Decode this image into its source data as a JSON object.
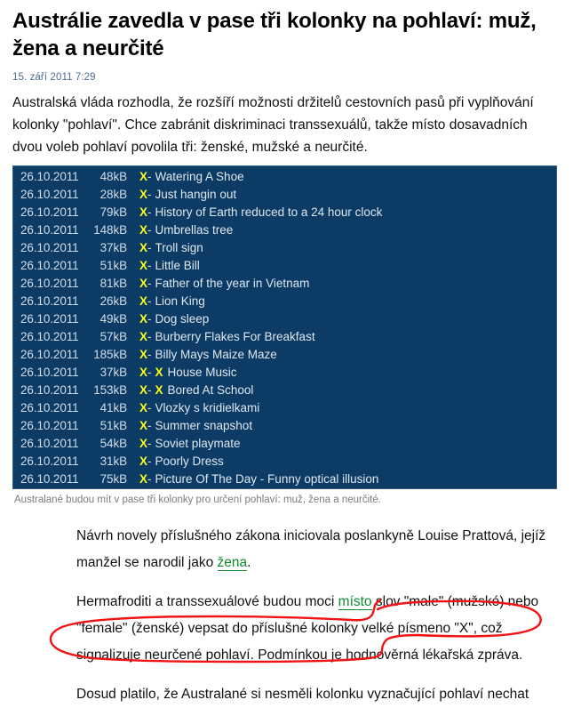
{
  "article": {
    "headline": "Austrálie zavedla v pase tři kolonky na pohlaví: muž, žena a neurčité",
    "dateline": "15. září 2011  7:29",
    "perex": "Australská vláda rozhodla, že rozšíří možnosti držitelů cestovních pasů při vyplňování kolonky \"pohlaví\". Chce zabránit diskriminaci transsexuálů, takže místo dosavadních dvou voleb pohlaví povolila tři: ženské, mužské a neurčité.",
    "image_caption": "Australané budou mít v pase tři kolonky pro určení pohlaví: muž, žena a neurčité."
  },
  "filebox": {
    "marker_glyph": "X",
    "separator": "-",
    "rows": [
      {
        "date": "26.10.2011",
        "size": "48kB",
        "marker": "X",
        "extra_marker": "",
        "title": "Watering A Shoe"
      },
      {
        "date": "26.10.2011",
        "size": "28kB",
        "marker": "X",
        "extra_marker": "",
        "title": "Just hangin out"
      },
      {
        "date": "26.10.2011",
        "size": "79kB",
        "marker": "X",
        "extra_marker": "",
        "title": "History of Earth reduced to a 24 hour clock"
      },
      {
        "date": "26.10.2011",
        "size": "148kB",
        "marker": "X",
        "extra_marker": "",
        "title": "Umbrellas tree"
      },
      {
        "date": "26.10.2011",
        "size": "37kB",
        "marker": "X",
        "extra_marker": "",
        "title": "Troll sign"
      },
      {
        "date": "26.10.2011",
        "size": "51kB",
        "marker": "X",
        "extra_marker": "",
        "title": "Little Bill"
      },
      {
        "date": "26.10.2011",
        "size": "81kB",
        "marker": "X",
        "extra_marker": "",
        "title": "Father of the year in Vietnam"
      },
      {
        "date": "26.10.2011",
        "size": "26kB",
        "marker": "X",
        "extra_marker": "",
        "title": "Lion King"
      },
      {
        "date": "26.10.2011",
        "size": "49kB",
        "marker": "X",
        "extra_marker": "",
        "title": "Dog sleep"
      },
      {
        "date": "26.10.2011",
        "size": "57kB",
        "marker": "X",
        "extra_marker": "",
        "title": "Burberry Flakes For Breakfast"
      },
      {
        "date": "26.10.2011",
        "size": "185kB",
        "marker": "X",
        "extra_marker": "",
        "title": "Billy Mays Maize Maze"
      },
      {
        "date": "26.10.2011",
        "size": "37kB",
        "marker": "X",
        "extra_marker": "X",
        "title": "House Music"
      },
      {
        "date": "26.10.2011",
        "size": "153kB",
        "marker": "X",
        "extra_marker": "X",
        "title": "Bored At School"
      },
      {
        "date": "26.10.2011",
        "size": "41kB",
        "marker": "X",
        "extra_marker": "",
        "title": "Vlozky s kridielkami"
      },
      {
        "date": "26.10.2011",
        "size": "51kB",
        "marker": "X",
        "extra_marker": "",
        "title": "Summer snapshot"
      },
      {
        "date": "26.10.2011",
        "size": "54kB",
        "marker": "X",
        "extra_marker": "",
        "title": "Soviet playmate"
      },
      {
        "date": "26.10.2011",
        "size": "31kB",
        "marker": "X",
        "extra_marker": "",
        "title": "Poorly Dress"
      },
      {
        "date": "26.10.2011",
        "size": "75kB",
        "marker": "X",
        "extra_marker": "",
        "title": "Picture Of The Day - Funny optical illusion"
      }
    ]
  },
  "body": {
    "para1_before_link": "Návrh novely příslušného zákona iniciovala poslankyně Louise Prattová, jejíž manžel se narodil jako ",
    "para1_link": "žena",
    "para1_after_link": ".",
    "para2_before_link": "Hermafroditi a transsexuálové budou moci ",
    "para2_link": "místo",
    "para2_after_link": " slov \"male\" (mužské) nebo \"female\" (ženské) vepsat do příslušné kolonky velké písmeno \"X\", což signalizuje neurčené pohlaví. Podmínkou je hodnověrná lékařská zpráva.",
    "para3": "Dosud platilo, že Australané si nesměli kolonku vyznačující pohlaví nechat"
  },
  "annotation": {
    "color": "#f01414",
    "circled_text": "velké písmeno \"X\", což signalizuje neurčené pohlaví."
  },
  "colors": {
    "filebox_background": "#0c3c66",
    "filebox_border": "#2f5d85",
    "marker_yellow": "#ffff1a",
    "link_green": "#0d8a2e",
    "dateline_blue": "#4c6b93",
    "caption_gray": "#7b7b7b",
    "annotation_red": "#f01414"
  }
}
